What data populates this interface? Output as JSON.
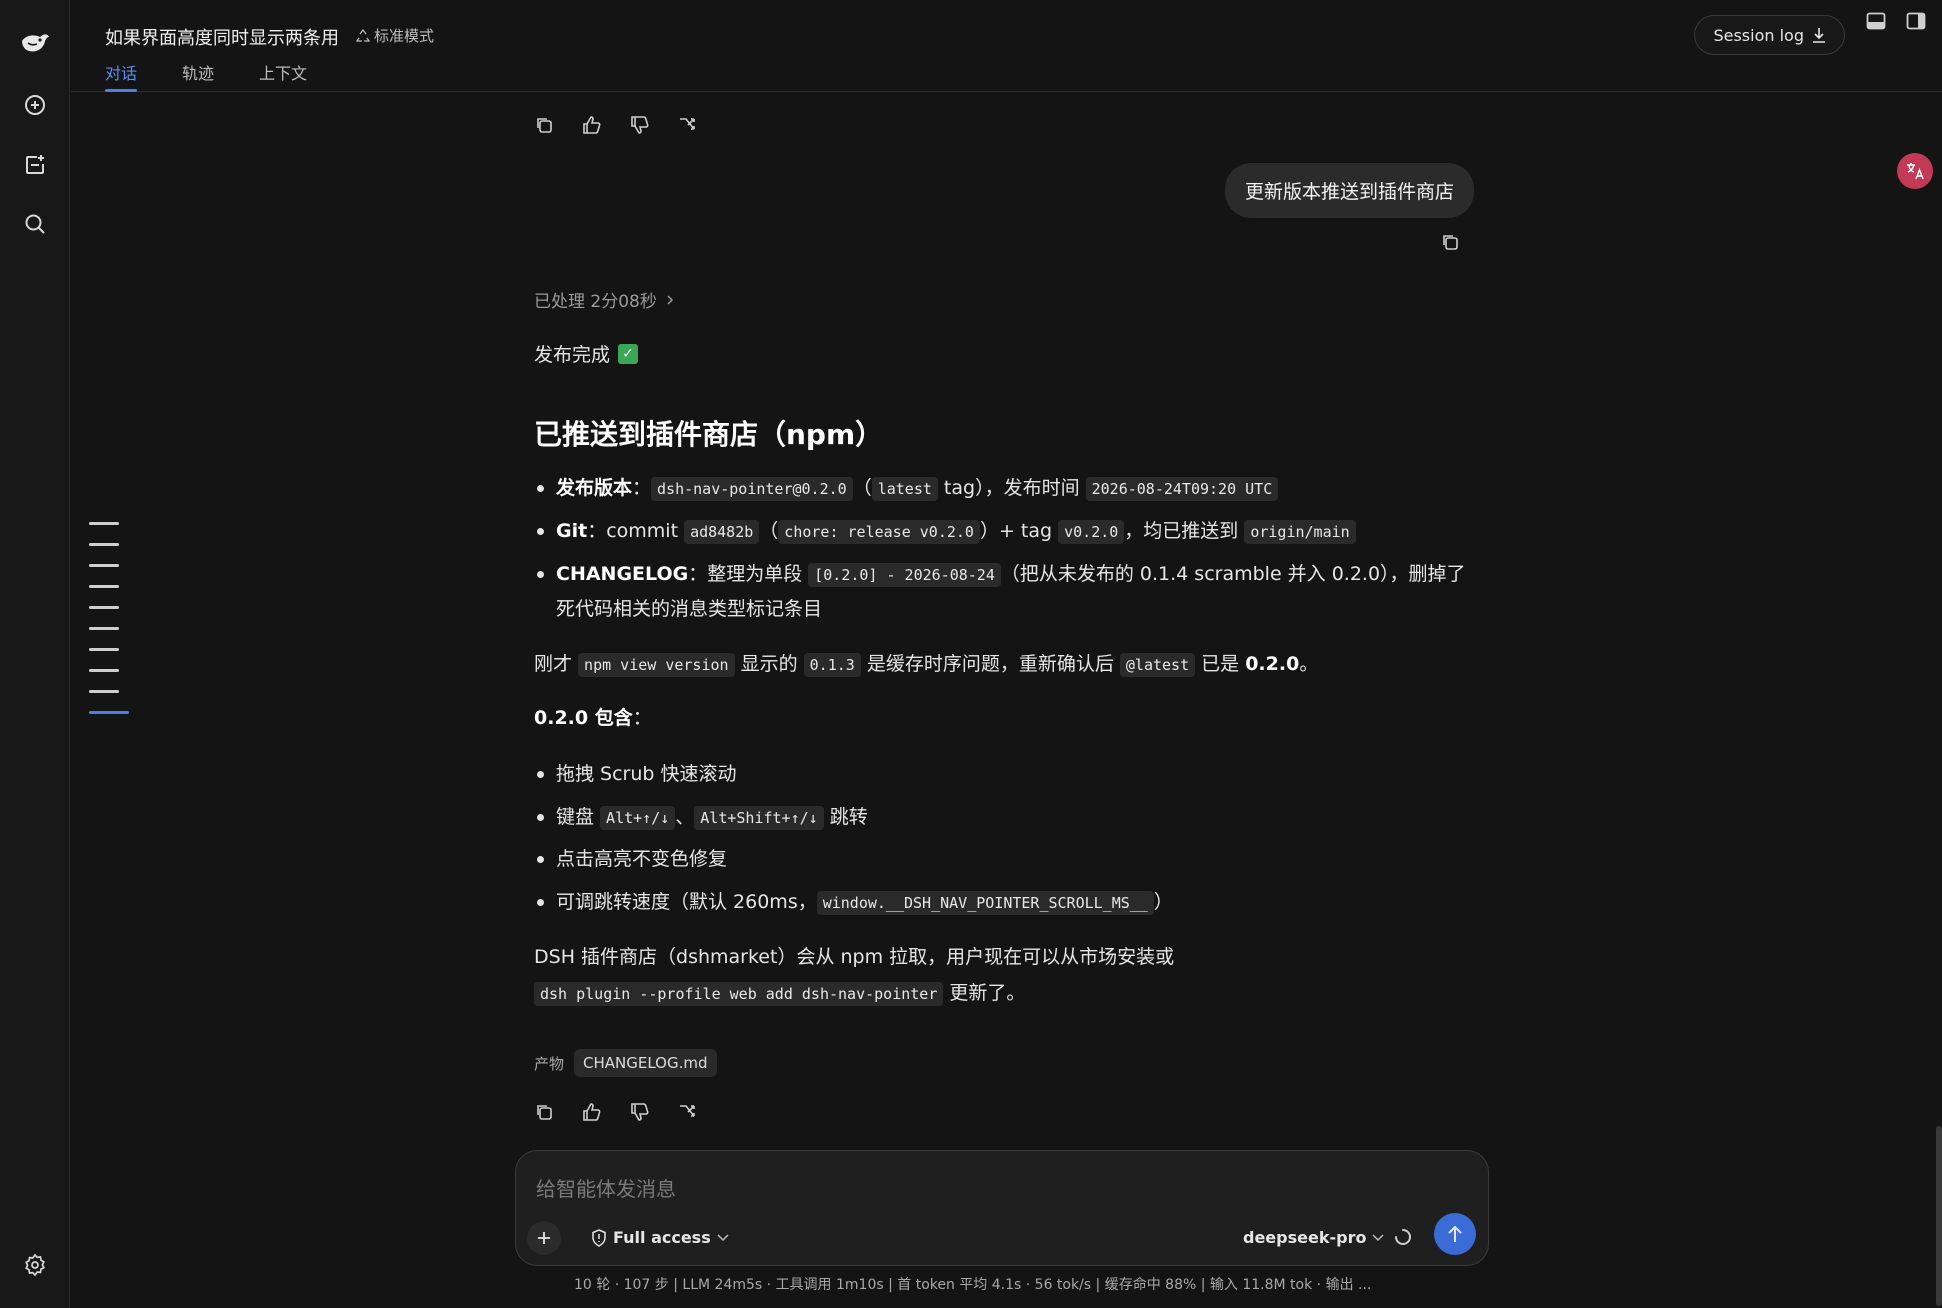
{
  "header": {
    "conversation_title": "如果界面高度同时显示两条用",
    "mode_label": "标准模式",
    "tabs": [
      {
        "label": "对话",
        "active": true
      },
      {
        "label": "轨迹",
        "active": false
      },
      {
        "label": "上下文",
        "active": false
      }
    ],
    "session_log_label": "Session log"
  },
  "user_message": "更新版本推送到插件商店",
  "processed_label": "已处理 2分08秒",
  "reply": {
    "done": "发布完成",
    "heading": "已推送到插件商店（npm）",
    "b1": {
      "label": "发布版本",
      "colon": "：",
      "code1": "dsh-nav-pointer@0.2.0",
      "p1": "（",
      "code2": "latest",
      "p2": " tag），发布时间 ",
      "code3": "2026-08-24T09:20 UTC"
    },
    "b2": {
      "label": "Git",
      "t1": "：commit ",
      "code1": "ad8482b",
      "p1": "（",
      "code2": "chore: release v0.2.0",
      "p2": "）+ tag ",
      "code3": "v0.2.0",
      "p3": "，均已推送到 ",
      "code4": "origin/main"
    },
    "b3": {
      "label": "CHANGELOG",
      "t1": "：整理为单段 ",
      "code1": "[0.2.0] - 2026-08-24",
      "t2": "（把从未发布的 0.1.4 scramble 并入 0.2.0），删掉了死代码相关的消息类型标记条目"
    },
    "p1": {
      "t1": "刚才 ",
      "code1": "npm view version",
      "t2": " 显示的 ",
      "code2": "0.1.3",
      "t3": " 是缓存时序问题，重新确认后 ",
      "code3": "@latest",
      "t4": " 已是 ",
      "bold": "0.2.0",
      "t5": "。"
    },
    "includes_label": "0.2.0 包含",
    "includes_colon": "：",
    "i1": "拖拽 Scrub 快速滚动",
    "i2": {
      "t1": "键盘 ",
      "code1": "Alt+↑/↓",
      "t2": "、",
      "code2": "Alt+Shift+↑/↓",
      "t3": " 跳转"
    },
    "i3": "点击高亮不变色修复",
    "i4": {
      "t1": "可调跳转速度（默认 260ms，",
      "code1": "window.__DSH_NAV_POINTER_SCROLL_MS__",
      "t2": "）"
    },
    "p2": {
      "t1": "DSH 插件商店（dshmarket）会从 npm 拉取，用户现在可以从市场安装或",
      "code1": "dsh plugin --profile web add dsh-nav-pointer",
      "t2": " 更新了。"
    },
    "artifact_label": "产物",
    "artifact_file": "CHANGELOG.md"
  },
  "composer": {
    "placeholder": "给智能体发消息",
    "access_label": "Full access",
    "model_label": "deepseek-pro"
  },
  "status_bar": "10 轮 · 107 步  |  LLM 24m5s · 工具调用 1m10s  |  首 token 平均 4.1s · 56 tok/s  |  缓存命中 88%  |  输入 11.8M tok · 输出 ...",
  "colors": {
    "accent": "#4d7fe8",
    "send": "#3a6bd6",
    "check": "#3aa757",
    "background": "#141414"
  }
}
